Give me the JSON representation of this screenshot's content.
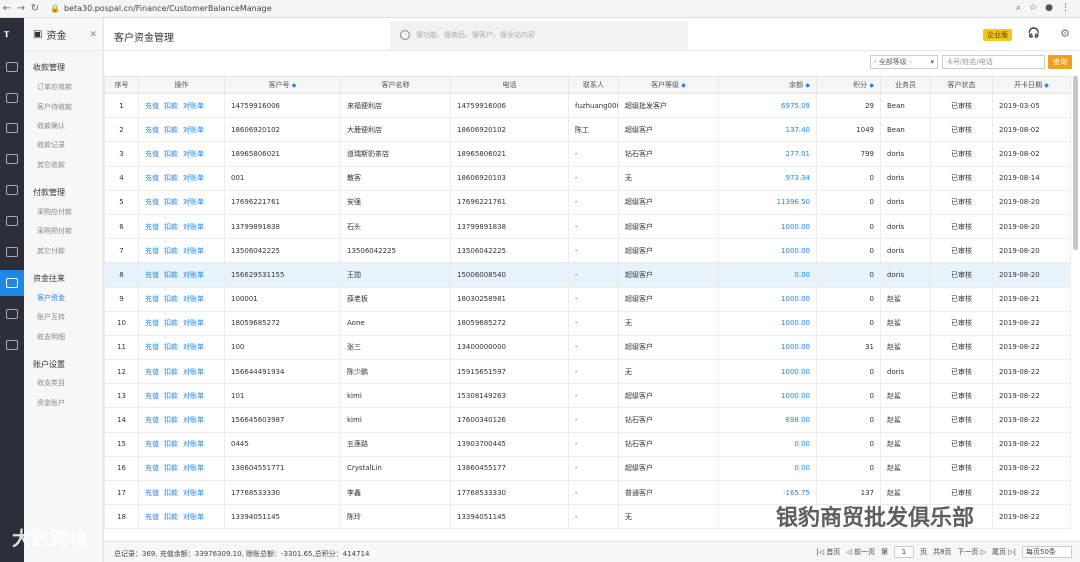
{
  "browser": {
    "url": "beta30.pospal.cn/Finance/CustomerBalanceManage"
  },
  "submenu": {
    "title": "资金",
    "groups": [
      {
        "label": "收款管理",
        "items": [
          "订单应收款",
          "客户待收款",
          "收款确认",
          "收款记录",
          "其它收款"
        ]
      },
      {
        "label": "付款管理",
        "items": [
          "采购应付款",
          "采购预付款",
          "其它付款"
        ]
      },
      {
        "label": "资金往来",
        "items": [
          "客户资金",
          "账户互转",
          "收支明细"
        ]
      },
      {
        "label": "账户设置",
        "items": [
          "收支类目",
          "资金账户"
        ]
      }
    ]
  },
  "header": {
    "title": "客户资金管理",
    "search_placeholder": "搜功能、搜商品、搜客户、搜全站内容",
    "edition_badge": "企业版"
  },
  "filter": {
    "level_select": "- 全部等级 -",
    "keyword_placeholder": "卡号/姓名/电话",
    "query_button": "查询"
  },
  "table": {
    "columns": [
      "序号",
      "操作",
      "客户号",
      "客户名称",
      "电话",
      "联系人",
      "客户等级",
      "余额",
      "积分",
      "业务员",
      "客户状态",
      "开卡日期"
    ],
    "ops": [
      "充值",
      "扣款",
      "对账单"
    ],
    "rows": [
      [
        "1",
        "14759916006",
        "来福便利店",
        "14759916006",
        "fuzhuang000",
        "超级批发客户",
        "6975.09",
        "29",
        "Bean",
        "已审核",
        "2019-03-05"
      ],
      [
        "2",
        "18606920102",
        "大鹿便利店",
        "18606920102",
        "陈工",
        "超级客户",
        "137.40",
        "1049",
        "Bean",
        "已审核",
        "2019-08-02"
      ],
      [
        "3",
        "18965806021",
        "道瑞斯奶茶店",
        "18965806021",
        "-",
        "钻石客户",
        "277.01",
        "799",
        "doris",
        "已审核",
        "2019-08-02"
      ],
      [
        "4",
        "001",
        "散客",
        "18606920103",
        "-",
        "无",
        "973.34",
        "0",
        "doris",
        "已审核",
        "2019-08-14"
      ],
      [
        "5",
        "17696221761",
        "安强",
        "17696221761",
        "-",
        "超级客户",
        "11396.50",
        "0",
        "doris",
        "已审核",
        "2019-08-20"
      ],
      [
        "6",
        "13799891838",
        "石头",
        "13799891838",
        "-",
        "超级客户",
        "1000.00",
        "0",
        "doris",
        "已审核",
        "2019-08-20"
      ],
      [
        "7",
        "13506042225",
        "13506042225",
        "13506042225",
        "-",
        "超级客户",
        "1000.00",
        "0",
        "doris",
        "已审核",
        "2019-08-20"
      ],
      [
        "8",
        "156629531155",
        "王勋",
        "15006008540",
        "-",
        "超级客户",
        "0.00",
        "0",
        "doris",
        "已审核",
        "2019-08-20"
      ],
      [
        "9",
        "100001",
        "薛老板",
        "18030258981",
        "-",
        "超级客户",
        "1000.00",
        "0",
        "赵鲨",
        "已审核",
        "2019-08-21"
      ],
      [
        "10",
        "18059685272",
        "Aone",
        "18059685272",
        "-",
        "无",
        "1000.00",
        "0",
        "赵鲨",
        "已审核",
        "2019-08-22"
      ],
      [
        "11",
        "100",
        "张三",
        "13400000000",
        "-",
        "超级客户",
        "1000.00",
        "31",
        "赵鲨",
        "已审核",
        "2019-08-22"
      ],
      [
        "12",
        "156644491934",
        "陈少鹏",
        "15915651597",
        "-",
        "无",
        "1000.00",
        "0",
        "doris",
        "已审核",
        "2019-08-22"
      ],
      [
        "13",
        "101",
        "kimi",
        "15308149263",
        "-",
        "超级客户",
        "1000.00",
        "0",
        "赵鲨",
        "已审核",
        "2019-08-22"
      ],
      [
        "14",
        "156645603987",
        "kimi",
        "17600340126",
        "-",
        "钻石客户",
        "698.00",
        "0",
        "赵鲨",
        "已审核",
        "2019-08-22"
      ],
      [
        "15",
        "0445",
        "五莲路",
        "13903700445",
        "-",
        "钻石客户",
        "0.00",
        "0",
        "赵鲨",
        "已审核",
        "2019-08-22"
      ],
      [
        "16",
        "138604551771",
        "CrystalLin",
        "13860455177",
        "-",
        "超级客户",
        "0.00",
        "0",
        "赵鲨",
        "已审核",
        "2019-08-22"
      ],
      [
        "17",
        "17768533330",
        "李鑫",
        "17768533330",
        "-",
        "普通客户",
        "-165.75",
        "137",
        "赵鲨",
        "已审核",
        "2019-08-22"
      ],
      [
        "18",
        "13394051145",
        "陈玲",
        "13394051145",
        "-",
        "无",
        "",
        "",
        "",
        "",
        "2019-08-22"
      ]
    ]
  },
  "footer": {
    "summary": "总记录：369, 充值余额：33976309.10, 赊账总额：-3301.65,总积分：414714",
    "first": "首页",
    "prev": "前一页",
    "page_label_pre": "第",
    "page": "1",
    "page_label_post": "页",
    "total_pages": "共8页",
    "next": "下一页",
    "last": "尾页",
    "page_size": "每页50条"
  },
  "watermarks": {
    "left": "大数跨境",
    "right": "银豹商贸批发俱乐部"
  },
  "colors": {
    "link": "#1e88e5",
    "query": "#f0a020",
    "badge": "#f5c518",
    "sidebar": "#2b2f3a"
  }
}
